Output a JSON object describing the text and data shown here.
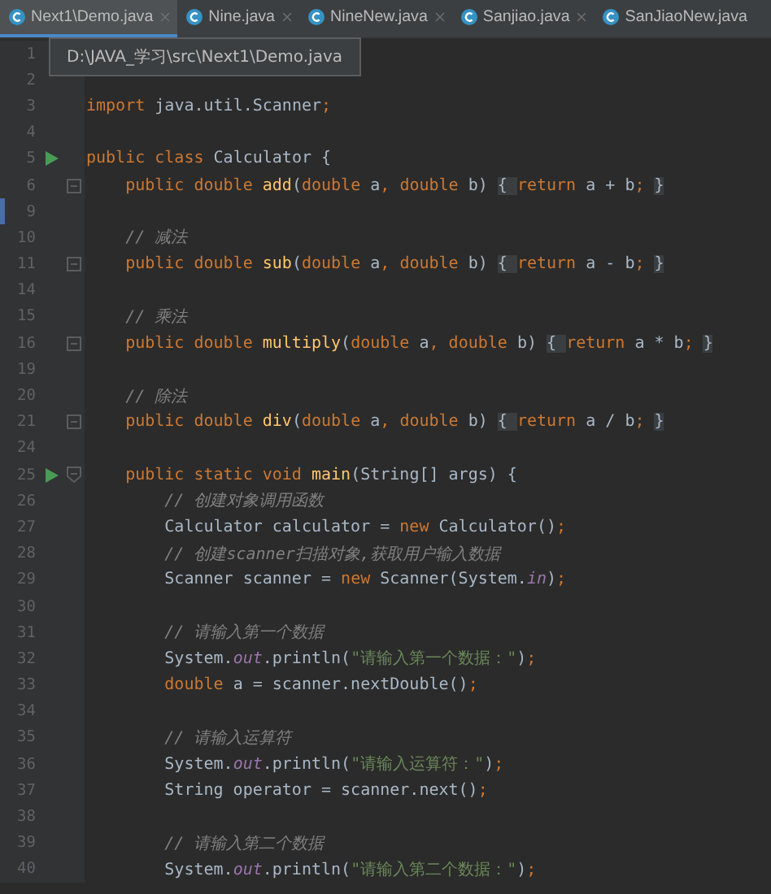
{
  "tabs": [
    {
      "label": "Next1\\Demo.java",
      "selected": true,
      "closable": true
    },
    {
      "label": "Nine.java",
      "selected": false,
      "closable": true
    },
    {
      "label": "NineNew.java",
      "selected": false,
      "closable": true
    },
    {
      "label": "Sanjiao.java",
      "selected": false,
      "closable": true
    },
    {
      "label": "SanJiaoNew.java",
      "selected": false,
      "closable": false
    }
  ],
  "tooltip": "D:\\JAVA_学习\\src\\Next1\\Demo.java",
  "lines": [
    {
      "number": "1",
      "runnable": false,
      "folded": false,
      "fold_start": false,
      "changed": false
    },
    {
      "number": "2",
      "runnable": false,
      "folded": false,
      "fold_start": false,
      "changed": false
    },
    {
      "number": "3",
      "runnable": false,
      "folded": false,
      "fold_start": false,
      "changed": false,
      "tokens": [
        {
          "kind": "kw",
          "text": "import "
        },
        {
          "kind": "plain",
          "text": "java.util.Scanner"
        },
        {
          "kind": "kw",
          "text": ";"
        }
      ]
    },
    {
      "number": "4",
      "runnable": false,
      "folded": false,
      "fold_start": false,
      "changed": false
    },
    {
      "number": "5",
      "runnable": true,
      "folded": false,
      "fold_start": false,
      "changed": false,
      "tokens": [
        {
          "kind": "kw",
          "text": "public class "
        },
        {
          "kind": "plain",
          "text": "Calculator {"
        }
      ]
    },
    {
      "number": "6",
      "runnable": false,
      "folded": true,
      "fold_start": false,
      "changed": false,
      "tokens": [
        {
          "kind": "kw",
          "text": "    public double "
        },
        {
          "kind": "fn",
          "text": "add"
        },
        {
          "kind": "plain",
          "text": "("
        },
        {
          "kind": "kw",
          "text": "double "
        },
        {
          "kind": "plain",
          "text": "a"
        },
        {
          "kind": "kw",
          "text": ", double "
        },
        {
          "kind": "plain",
          "text": "b) "
        },
        {
          "kind": "fold",
          "text": "{ "
        },
        {
          "kind": "kw",
          "text": "return "
        },
        {
          "kind": "plain",
          "text": "a + b"
        },
        {
          "kind": "kw",
          "text": "; "
        },
        {
          "kind": "fold",
          "text": "}"
        }
      ]
    },
    {
      "number": "9",
      "runnable": false,
      "folded": false,
      "fold_start": false,
      "changed": true
    },
    {
      "number": "10",
      "runnable": false,
      "folded": false,
      "fold_start": false,
      "changed": false,
      "tokens": [
        {
          "kind": "comment",
          "text": "    // 减法"
        }
      ]
    },
    {
      "number": "11",
      "runnable": false,
      "folded": true,
      "fold_start": false,
      "changed": false,
      "tokens": [
        {
          "kind": "kw",
          "text": "    public double "
        },
        {
          "kind": "fn",
          "text": "sub"
        },
        {
          "kind": "plain",
          "text": "("
        },
        {
          "kind": "kw",
          "text": "double "
        },
        {
          "kind": "plain",
          "text": "a"
        },
        {
          "kind": "kw",
          "text": ", double "
        },
        {
          "kind": "plain",
          "text": "b) "
        },
        {
          "kind": "fold",
          "text": "{ "
        },
        {
          "kind": "kw",
          "text": "return "
        },
        {
          "kind": "plain",
          "text": "a - b"
        },
        {
          "kind": "kw",
          "text": "; "
        },
        {
          "kind": "fold",
          "text": "}"
        }
      ]
    },
    {
      "number": "14",
      "runnable": false,
      "folded": false,
      "fold_start": false,
      "changed": false
    },
    {
      "number": "15",
      "runnable": false,
      "folded": false,
      "fold_start": false,
      "changed": false,
      "tokens": [
        {
          "kind": "comment",
          "text": "    // 乘法"
        }
      ]
    },
    {
      "number": "16",
      "runnable": false,
      "folded": true,
      "fold_start": false,
      "changed": false,
      "tokens": [
        {
          "kind": "kw",
          "text": "    public double "
        },
        {
          "kind": "fn",
          "text": "multiply"
        },
        {
          "kind": "plain",
          "text": "("
        },
        {
          "kind": "kw",
          "text": "double "
        },
        {
          "kind": "plain",
          "text": "a"
        },
        {
          "kind": "kw",
          "text": ", double "
        },
        {
          "kind": "plain",
          "text": "b) "
        },
        {
          "kind": "fold",
          "text": "{ "
        },
        {
          "kind": "kw",
          "text": "return "
        },
        {
          "kind": "plain",
          "text": "a * b"
        },
        {
          "kind": "kw",
          "text": "; "
        },
        {
          "kind": "fold",
          "text": "}"
        }
      ]
    },
    {
      "number": "19",
      "runnable": false,
      "folded": false,
      "fold_start": false,
      "changed": false
    },
    {
      "number": "20",
      "runnable": false,
      "folded": false,
      "fold_start": false,
      "changed": false,
      "tokens": [
        {
          "kind": "comment",
          "text": "    // 除法"
        }
      ]
    },
    {
      "number": "21",
      "runnable": false,
      "folded": true,
      "fold_start": false,
      "changed": false,
      "tokens": [
        {
          "kind": "kw",
          "text": "    public double "
        },
        {
          "kind": "fn",
          "text": "div"
        },
        {
          "kind": "plain",
          "text": "("
        },
        {
          "kind": "kw",
          "text": "double "
        },
        {
          "kind": "plain",
          "text": "a"
        },
        {
          "kind": "kw",
          "text": ", double "
        },
        {
          "kind": "plain",
          "text": "b) "
        },
        {
          "kind": "fold",
          "text": "{ "
        },
        {
          "kind": "kw",
          "text": "return "
        },
        {
          "kind": "plain",
          "text": "a / b"
        },
        {
          "kind": "kw",
          "text": "; "
        },
        {
          "kind": "fold",
          "text": "}"
        }
      ]
    },
    {
      "number": "24",
      "runnable": false,
      "folded": false,
      "fold_start": false,
      "changed": false
    },
    {
      "number": "25",
      "runnable": true,
      "folded": false,
      "fold_start": true,
      "changed": false,
      "tokens": [
        {
          "kind": "kw",
          "text": "    public static void "
        },
        {
          "kind": "fn",
          "text": "main"
        },
        {
          "kind": "plain",
          "text": "(String[] args) {"
        }
      ]
    },
    {
      "number": "26",
      "runnable": false,
      "folded": false,
      "fold_start": false,
      "changed": false,
      "tokens": [
        {
          "kind": "comment",
          "text": "        // 创建对象调用函数"
        }
      ]
    },
    {
      "number": "27",
      "runnable": false,
      "folded": false,
      "fold_start": false,
      "changed": false,
      "tokens": [
        {
          "kind": "plain",
          "text": "        Calculator calculator = "
        },
        {
          "kind": "kw",
          "text": "new "
        },
        {
          "kind": "plain",
          "text": "Calculator()"
        },
        {
          "kind": "kw",
          "text": ";"
        }
      ]
    },
    {
      "number": "28",
      "runnable": false,
      "folded": false,
      "fold_start": false,
      "changed": false,
      "tokens": [
        {
          "kind": "comment",
          "text": "        // 创建scanner扫描对象,获取用户输入数据"
        }
      ]
    },
    {
      "number": "29",
      "runnable": false,
      "folded": false,
      "fold_start": false,
      "changed": false,
      "tokens": [
        {
          "kind": "plain",
          "text": "        Scanner scanner = "
        },
        {
          "kind": "kw",
          "text": "new "
        },
        {
          "kind": "plain",
          "text": "Scanner(System."
        },
        {
          "kind": "field",
          "text": "in"
        },
        {
          "kind": "plain",
          "text": ")"
        },
        {
          "kind": "kw",
          "text": ";"
        }
      ]
    },
    {
      "number": "30",
      "runnable": false,
      "folded": false,
      "fold_start": false,
      "changed": false
    },
    {
      "number": "31",
      "runnable": false,
      "folded": false,
      "fold_start": false,
      "changed": false,
      "tokens": [
        {
          "kind": "comment",
          "text": "        // 请输入第一个数据"
        }
      ]
    },
    {
      "number": "32",
      "runnable": false,
      "folded": false,
      "fold_start": false,
      "changed": false,
      "tokens": [
        {
          "kind": "plain",
          "text": "        System."
        },
        {
          "kind": "field",
          "text": "out"
        },
        {
          "kind": "plain",
          "text": ".println("
        },
        {
          "kind": "str",
          "text": "\"请输入第一个数据：\""
        },
        {
          "kind": "plain",
          "text": ")"
        },
        {
          "kind": "kw",
          "text": ";"
        }
      ]
    },
    {
      "number": "33",
      "runnable": false,
      "folded": false,
      "fold_start": false,
      "changed": false,
      "tokens": [
        {
          "kind": "kw",
          "text": "        double "
        },
        {
          "kind": "plain",
          "text": "a = scanner.nextDouble()"
        },
        {
          "kind": "kw",
          "text": ";"
        }
      ]
    },
    {
      "number": "34",
      "runnable": false,
      "folded": false,
      "fold_start": false,
      "changed": false
    },
    {
      "number": "35",
      "runnable": false,
      "folded": false,
      "fold_start": false,
      "changed": false,
      "tokens": [
        {
          "kind": "comment",
          "text": "        // 请输入运算符"
        }
      ]
    },
    {
      "number": "36",
      "runnable": false,
      "folded": false,
      "fold_start": false,
      "changed": false,
      "tokens": [
        {
          "kind": "plain",
          "text": "        System."
        },
        {
          "kind": "field",
          "text": "out"
        },
        {
          "kind": "plain",
          "text": ".println("
        },
        {
          "kind": "str",
          "text": "\"请输入运算符：\""
        },
        {
          "kind": "plain",
          "text": ")"
        },
        {
          "kind": "kw",
          "text": ";"
        }
      ]
    },
    {
      "number": "37",
      "runnable": false,
      "folded": false,
      "fold_start": false,
      "changed": false,
      "tokens": [
        {
          "kind": "plain",
          "text": "        String operator = scanner.next()"
        },
        {
          "kind": "kw",
          "text": ";"
        }
      ]
    },
    {
      "number": "38",
      "runnable": false,
      "folded": false,
      "fold_start": false,
      "changed": false
    },
    {
      "number": "39",
      "runnable": false,
      "folded": false,
      "fold_start": false,
      "changed": false,
      "tokens": [
        {
          "kind": "comment",
          "text": "        // 请输入第二个数据"
        }
      ]
    },
    {
      "number": "40",
      "runnable": false,
      "folded": false,
      "fold_start": false,
      "changed": false,
      "tokens": [
        {
          "kind": "plain",
          "text": "        System."
        },
        {
          "kind": "field",
          "text": "out"
        },
        {
          "kind": "plain",
          "text": ".println("
        },
        {
          "kind": "str",
          "text": "\"请输入第二个数据：\""
        },
        {
          "kind": "plain",
          "text": ")"
        },
        {
          "kind": "kw",
          "text": ";"
        }
      ]
    }
  ]
}
